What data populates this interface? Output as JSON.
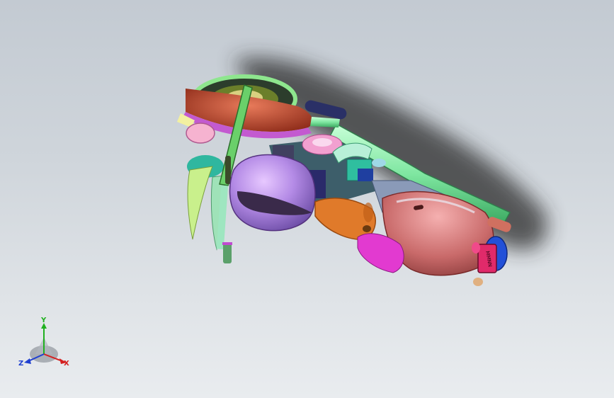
{
  "viewport": {
    "background_top": "#c3cad2",
    "background_bottom": "#e9ecef"
  },
  "model": {
    "description_icon": "motorcycle-assembly-icon",
    "license_plate_text": "MMNN"
  },
  "triad": {
    "x_label": "X",
    "y_label": "Y",
    "z_label": "Z",
    "x_color": "#d42020",
    "y_color": "#20b020",
    "z_color": "#2040d0"
  }
}
